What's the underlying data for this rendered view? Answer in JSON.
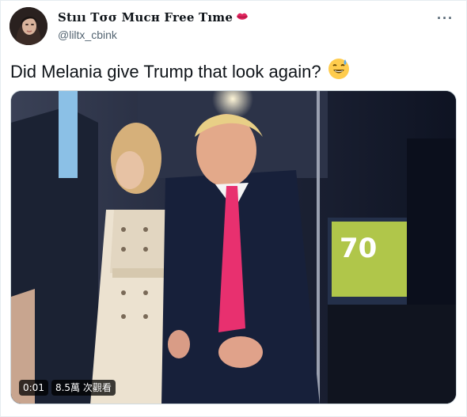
{
  "author": {
    "display_name": "Stııı Tσσ Mucн Free Tıme",
    "handle": "@liltx_cbink",
    "name_emoji_icon": "lips-icon"
  },
  "tweet": {
    "text": "Did Melania give Trump that look again?",
    "emoji_icon": "grinning-sweat-face-icon"
  },
  "menu": {
    "more_label": "···"
  },
  "video": {
    "elapsed": "0:01",
    "views": "8.5萬 次觀看"
  },
  "colors": {
    "handle": "#536471",
    "border": "#cfd9de",
    "lips": "#e0245e"
  }
}
